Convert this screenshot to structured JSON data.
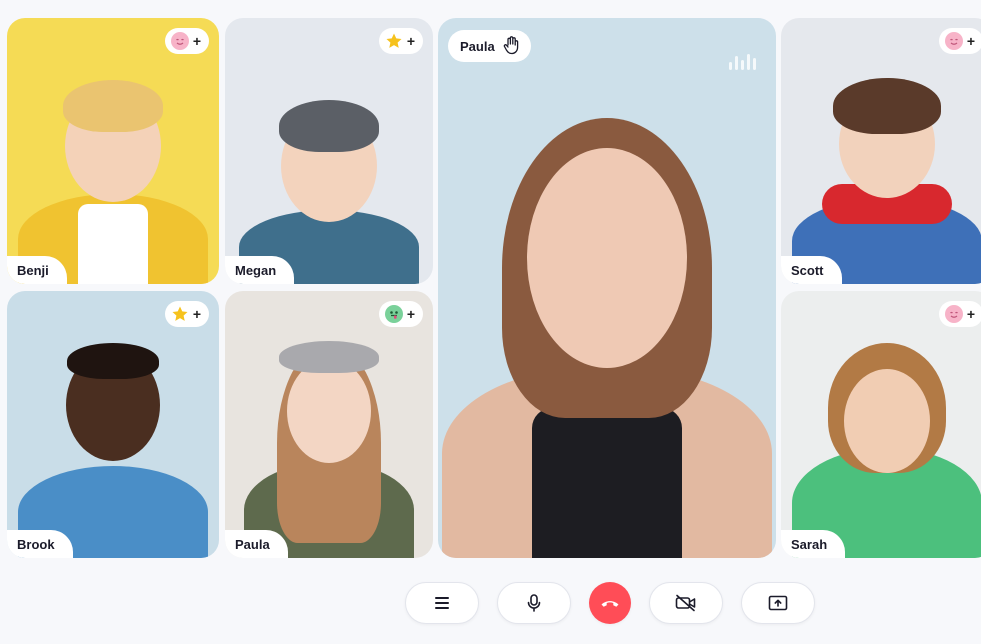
{
  "participants": [
    {
      "name": "Benji",
      "reaction_icon": "smiling-face-icon",
      "reaction_color": "#f7b3c8",
      "bg": "#f5db55"
    },
    {
      "name": "Megan",
      "reaction_icon": "star-icon",
      "reaction_color": "#f6c21d",
      "bg": "#e4e8ee"
    },
    {
      "name": "Scott",
      "reaction_icon": "smiling-face-icon",
      "reaction_color": "#f7b3c8",
      "bg": "#e5e8ed"
    },
    {
      "name": "Brook",
      "reaction_icon": "star-icon",
      "reaction_color": "#f6c21d",
      "bg": "#c9dde8"
    },
    {
      "name": "Paula",
      "reaction_icon": "tongue-face-icon",
      "reaction_color": "#7ad19a",
      "bg": "#e8e4df"
    },
    {
      "name": "Sarah",
      "reaction_icon": "smiling-face-icon",
      "reaction_color": "#f7b3c8",
      "bg": "#eceeee"
    }
  ],
  "add_reaction_symbol": "+",
  "speaker": {
    "name": "Paula",
    "icon": "raised-hand-icon",
    "status_icon": "audio-level-icon",
    "bg": "#cde0ea"
  },
  "controls": [
    {
      "name": "menu",
      "icon": "hamburger-menu-icon"
    },
    {
      "name": "microphone",
      "icon": "microphone-icon"
    },
    {
      "name": "end-call",
      "icon": "hang-up-icon",
      "color": "#ff4d57"
    },
    {
      "name": "camera-off",
      "icon": "video-off-icon"
    },
    {
      "name": "share-screen",
      "icon": "screen-share-icon"
    }
  ]
}
